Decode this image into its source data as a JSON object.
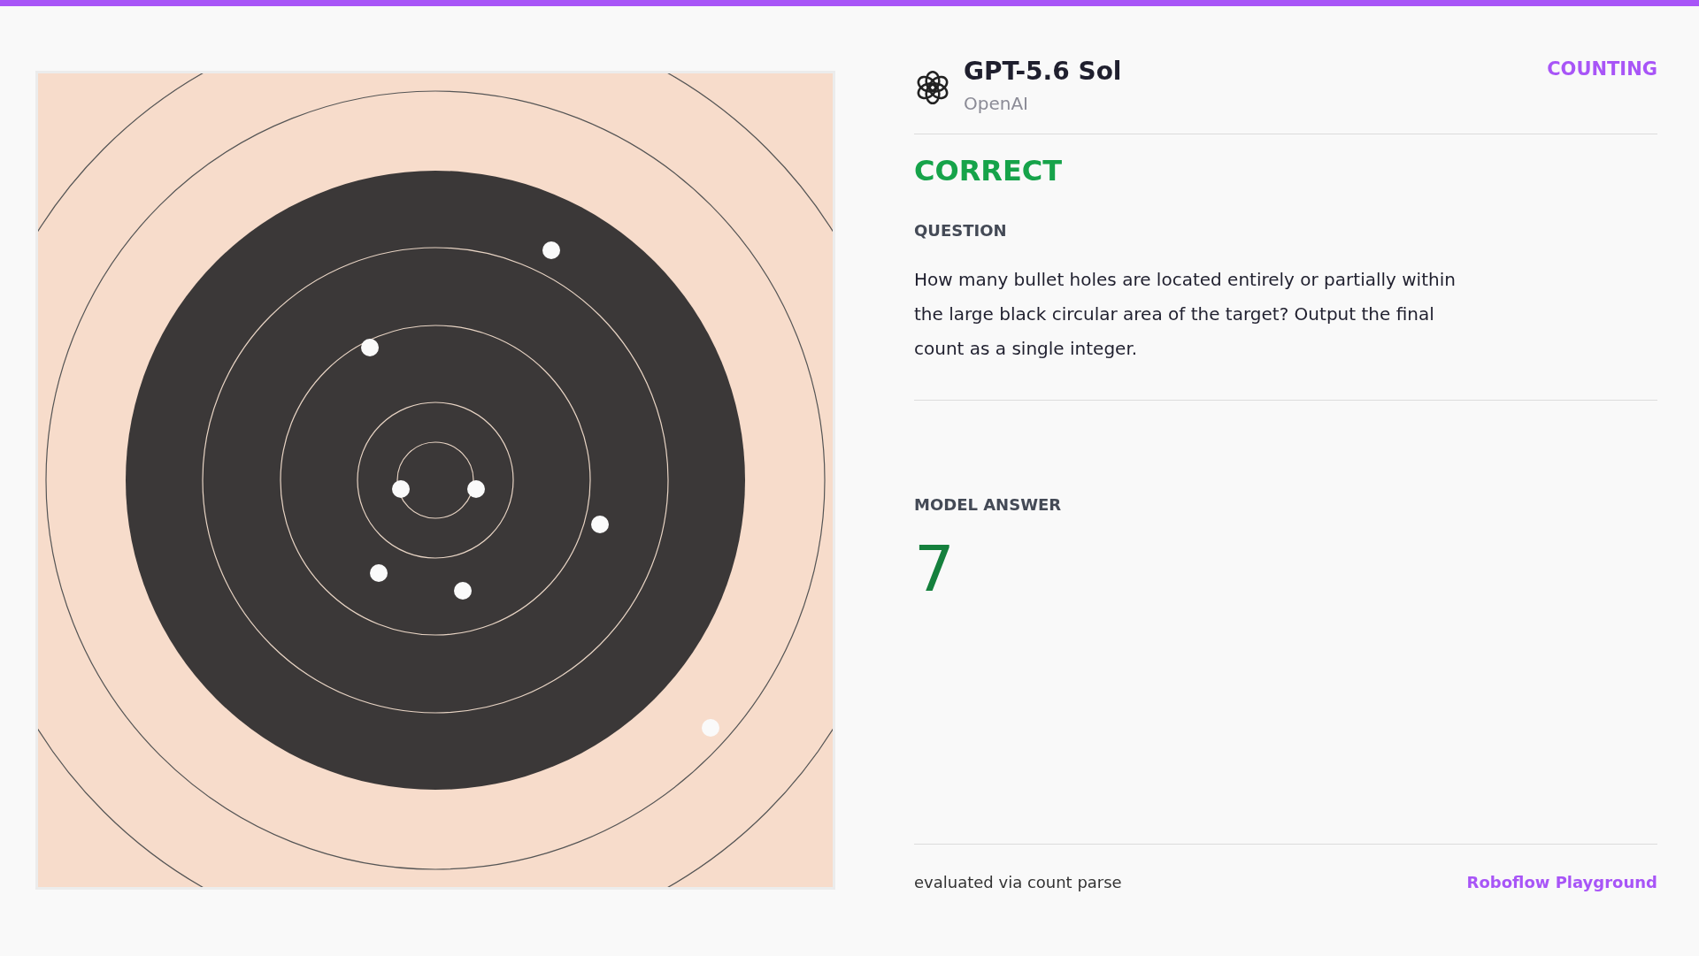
{
  "model": {
    "name": "GPT-5.6 Sol",
    "provider": "OpenAI"
  },
  "category": "COUNTING",
  "verdict": {
    "text": "CORRECT",
    "kind": "correct"
  },
  "question": {
    "label": "QUESTION",
    "text": "How many bullet holes are located entirely or partially within the large black circular area of the target? Output the final count as a single integer."
  },
  "answer": {
    "label": "MODEL ANSWER",
    "text": "7"
  },
  "footer": {
    "note": "evaluated via count parse",
    "link": "Roboflow Playground"
  }
}
